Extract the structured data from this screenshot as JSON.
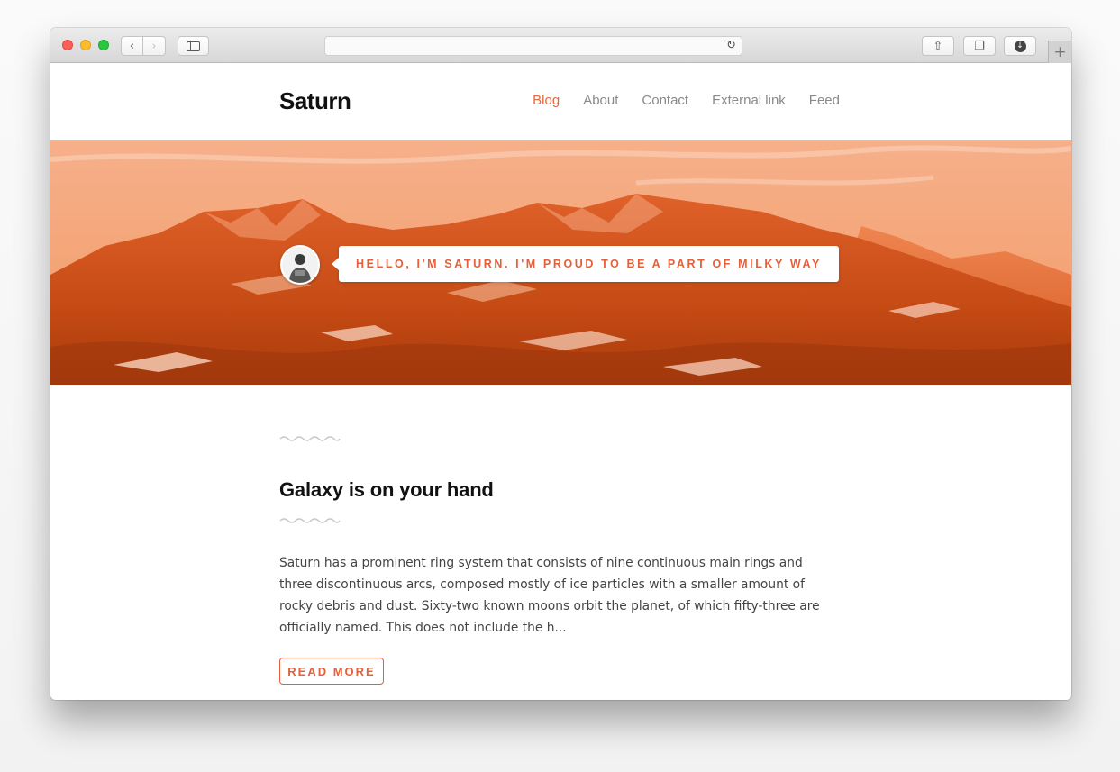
{
  "browser": {
    "back_glyph": "‹",
    "forward_glyph": "›",
    "reload_glyph": "↻",
    "share_glyph": "⇧",
    "tabs_glyph": "❐",
    "download_glyph": "↓",
    "newtab_glyph": "+",
    "url": ""
  },
  "site": {
    "brand": "Saturn",
    "accent_color": "#e9663a",
    "nav": [
      {
        "label": "Blog",
        "active": true
      },
      {
        "label": "About",
        "active": false
      },
      {
        "label": "Contact",
        "active": false
      },
      {
        "label": "External link",
        "active": false
      },
      {
        "label": "Feed",
        "active": false
      }
    ]
  },
  "hero": {
    "greeting": "HELLO, I'M SATURN. I'M PROUD TO BE A PART OF MILKY WAY",
    "avatar_icon": "person-avatar-icon"
  },
  "post": {
    "title": "Galaxy is on your hand",
    "excerpt": "Saturn has a prominent ring system that consists of nine continuous main rings and three discontinuous arcs, composed mostly of ice particles with a smaller amount of rocky debris and dust. Sixty-two known moons orbit the planet, of which fifty-three are officially named. This does not include the h...",
    "read_more": "READ MORE"
  }
}
